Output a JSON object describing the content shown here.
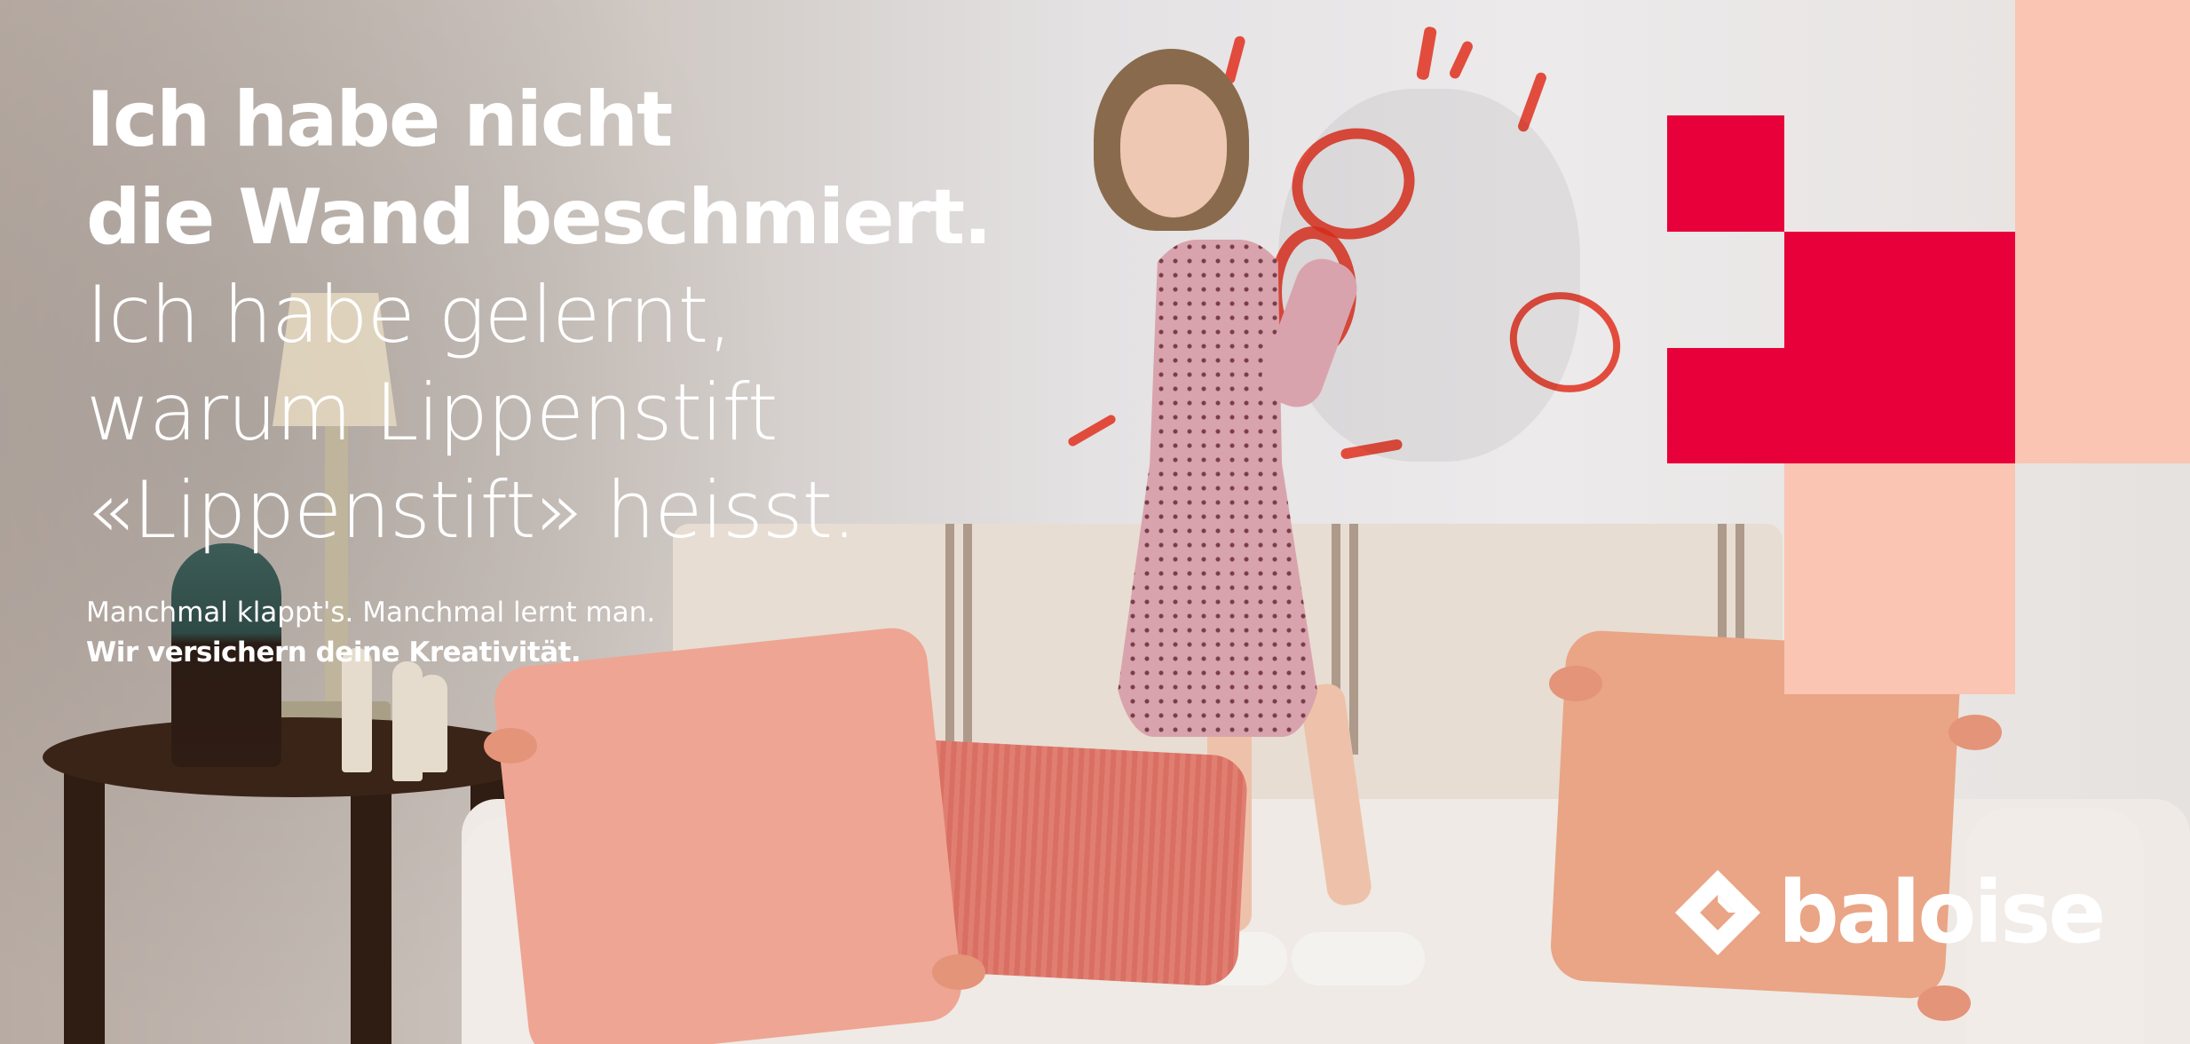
{
  "headline": {
    "bold_line_1": "Ich habe nicht",
    "bold_line_2": "die Wand beschmiert.",
    "light_line_1": "Ich habe gelernt,",
    "light_line_2": "warum Lippenstift",
    "light_line_3": "«Lippenstift» heisst."
  },
  "subline": {
    "regular": "Manchmal klappt's. Manchmal lernt man.",
    "bold": "Wir versichern deine Kreativität."
  },
  "logo": {
    "wordmark": "baloise",
    "icon": "baloise-diamond-icon"
  },
  "colors": {
    "brand_red": "#e8003a",
    "brand_pink": "#fac5b2",
    "text": "#ffffff"
  }
}
